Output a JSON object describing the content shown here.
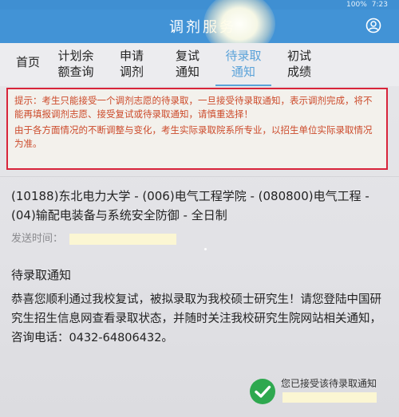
{
  "status_bar": {
    "battery": "100%",
    "time": "7:23"
  },
  "app_bar": {
    "title": "调剂服务",
    "user_icon": "user-circle-icon"
  },
  "tabs": [
    {
      "line1": "首页",
      "line2": ""
    },
    {
      "line1": "计划余",
      "line2": "额查询"
    },
    {
      "line1": "申请",
      "line2": "调剂"
    },
    {
      "line1": "复试",
      "line2": "通知"
    },
    {
      "line1": "待录取",
      "line2": "通知"
    },
    {
      "line1": "初试",
      "line2": "成绩"
    }
  ],
  "active_tab": "待录取通知",
  "notice": {
    "tip": "提示：考生只能接受一个调剂志愿的待录取，一旦接受待录取通知，表示调剂完成，将不能再填报调剂志愿、接受复试或待录取通知，请慎重选择！",
    "note": "由于各方面情况的不断调整与变化，考生实际录取院系所专业，以招生单位实际录取情况为准。"
  },
  "program": "(10188)东北电力大学 - (006)电气工程学院 - (080800)电气工程 - (04)输配电装备与系统安全防御 - 全日制",
  "send_time_label": "发送时间：",
  "section_title": "待录取通知",
  "body": "恭喜您顺利通过我校复试，被拟录取为我校硕士研究生！请您登陆中国研究生招生信息网查看录取状态，并随时关注我校研究生院网站相关通知，咨询电话：0432-64806432。",
  "accept_status": "您已接受该待录取通知",
  "colors": {
    "primary": "#4293d6",
    "notice_border": "#d8243a",
    "notice_text": "#cc4a2a",
    "active_tab": "#5aa2d9",
    "success": "#2ea84f"
  }
}
